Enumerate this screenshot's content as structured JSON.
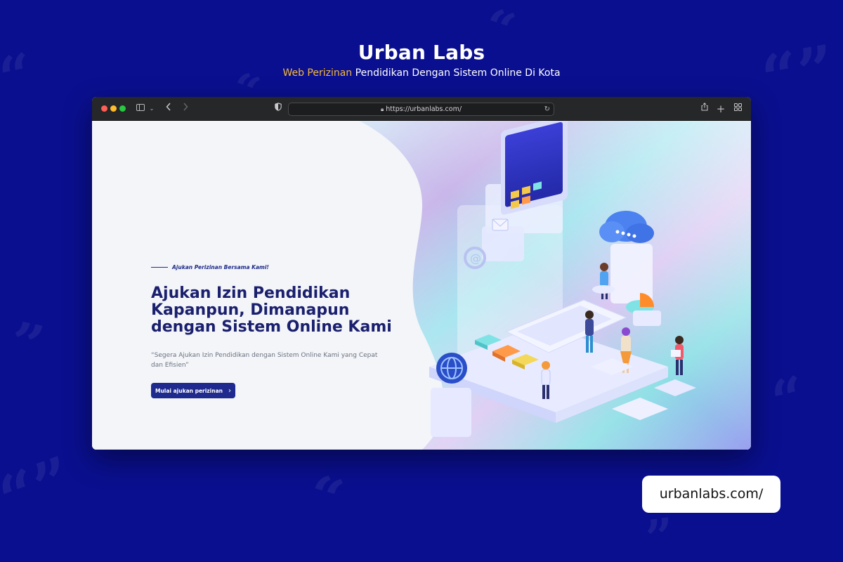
{
  "brand": {
    "title": "Urban Labs",
    "subtitle_accent": "Web Perizinan",
    "subtitle_rest": " Pendidikan Dengan Sistem Online Di Kota"
  },
  "browser": {
    "url": "https://urbanlabs.com/",
    "icons": {
      "sidebar": "sidebar-icon",
      "back": "chevron-left-icon",
      "forward": "chevron-right-icon",
      "privacy": "shield-icon",
      "lock": "lock-icon",
      "reload": "reload-icon",
      "share": "share-icon",
      "new_tab": "plus-icon",
      "tab_overview": "grid-icon"
    }
  },
  "hero": {
    "eyebrow": "Ajukan Perizinan Bersama Kami!",
    "headline_lines": [
      "Ajukan Izin Pendidikan",
      "Kapanpun, Dimanapun",
      "dengan Sistem Online Kami"
    ],
    "description": "“Segera Ajukan Izin Pendidikan dengan Sistem Online Kami yang Cepat dan Efisien”",
    "cta_label": "Mulai ajukan perizinan"
  },
  "footer_chip": {
    "url_text": "urbanlabs.com/"
  },
  "colors": {
    "background": "#0a0f8f",
    "accent": "#f5b93a",
    "primary": "#1f2a8f",
    "headline": "#1a1f6e"
  }
}
